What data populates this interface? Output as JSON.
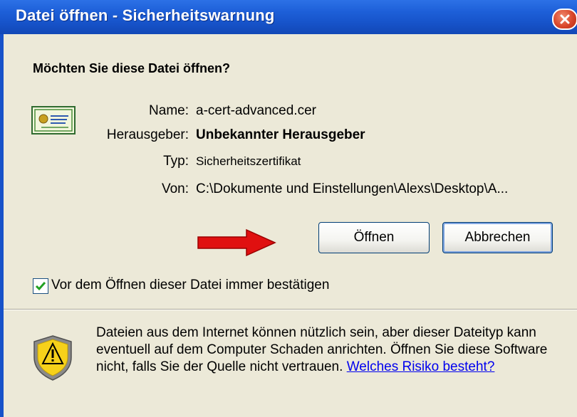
{
  "window": {
    "title": "Datei öffnen - Sicherheitswarnung"
  },
  "dialog": {
    "question": "Möchten Sie diese Datei öffnen?",
    "fields": {
      "name_label": "Name:",
      "name_value": "a-cert-advanced.cer",
      "publisher_label": "Herausgeber:",
      "publisher_value": "Unbekannter Herausgeber",
      "type_label": "Typ:",
      "type_value": "Sicherheitszertifikat",
      "from_label": "Von:",
      "from_value": "C:\\Dokumente und Einstellungen\\Alexs\\Desktop\\A..."
    },
    "buttons": {
      "open": "Öffnen",
      "cancel": "Abbrechen"
    },
    "checkbox": {
      "label": "Vor dem Öffnen dieser Datei immer bestätigen",
      "checked": true
    },
    "warning": {
      "text": "Dateien aus dem Internet können nützlich sein, aber dieser Dateityp kann eventuell auf dem Computer Schaden anrichten. Öffnen Sie diese Software nicht, falls Sie der Quelle nicht vertrauen.",
      "link": "Welches Risiko besteht?"
    }
  },
  "icons": {
    "close": "close-icon",
    "certificate": "certificate-icon",
    "arrow": "red-arrow-icon",
    "checkmark": "checkmark-icon",
    "shield": "shield-warning-icon"
  },
  "colors": {
    "titlebar": "#1d5fd8",
    "window_bg": "#ece9d8",
    "close_button": "#d9462a",
    "arrow": "#e01010",
    "link": "#0000ee",
    "shield_yellow": "#f6d11a"
  }
}
